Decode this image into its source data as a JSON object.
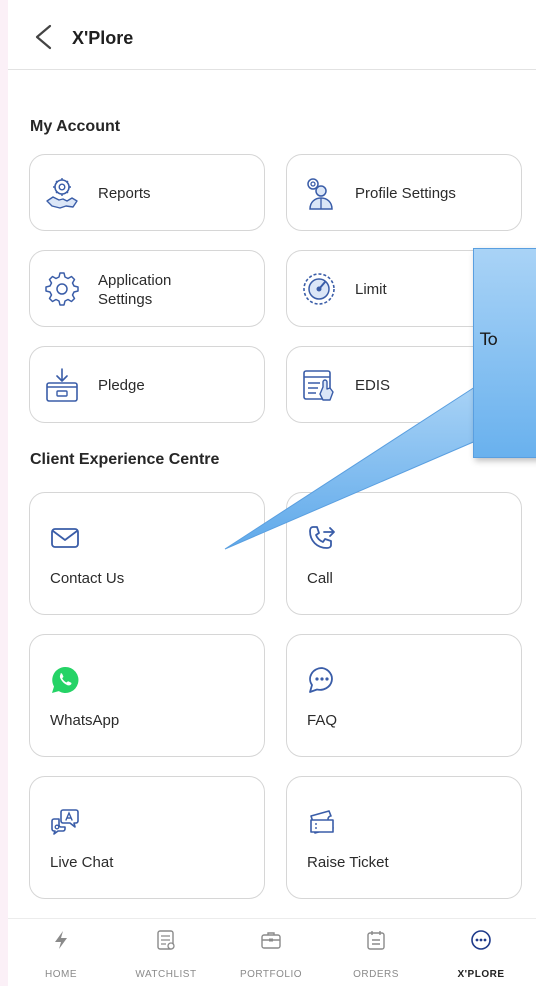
{
  "header": {
    "title": "X'Plore"
  },
  "my_account": {
    "title": "My Account",
    "items": [
      {
        "label": "Reports",
        "icon": "handshake-gear-icon"
      },
      {
        "label": "Profile Settings",
        "icon": "profile-gear-icon"
      },
      {
        "label": "Application Settings",
        "label_line1": "Application",
        "label_line2": "Settings",
        "icon": "gear-icon"
      },
      {
        "label": "Limit",
        "icon": "gauge-icon"
      },
      {
        "label": "Pledge",
        "icon": "pledge-box-icon"
      },
      {
        "label": "EDIS",
        "icon": "edis-document-icon"
      }
    ]
  },
  "client_experience": {
    "title": "Client Experience Centre",
    "items": [
      {
        "label": "Contact Us",
        "icon": "mail-icon"
      },
      {
        "label": "Call",
        "icon": "phone-forward-icon"
      },
      {
        "label": "WhatsApp",
        "icon": "whatsapp-icon",
        "color": "#25d366"
      },
      {
        "label": "FAQ",
        "icon": "chat-bubble-icon"
      },
      {
        "label": "Live Chat",
        "icon": "live-chat-icon"
      },
      {
        "label": "Raise Ticket",
        "icon": "ticket-icon"
      }
    ]
  },
  "bottom_nav": [
    {
      "label": "HOME",
      "icon": "lightning-icon"
    },
    {
      "label": "WATCHLIST",
      "icon": "watchlist-icon"
    },
    {
      "label": "PORTFOLIO",
      "icon": "briefcase-icon"
    },
    {
      "label": "ORDERS",
      "icon": "orders-icon"
    },
    {
      "label": "X'PLORE",
      "icon": "more-dots-icon",
      "active": true
    }
  ],
  "callout": {
    "text": "To"
  },
  "colors": {
    "accent": "#1e88e5",
    "callout": "#7fbdf0",
    "whatsapp": "#25d366"
  }
}
